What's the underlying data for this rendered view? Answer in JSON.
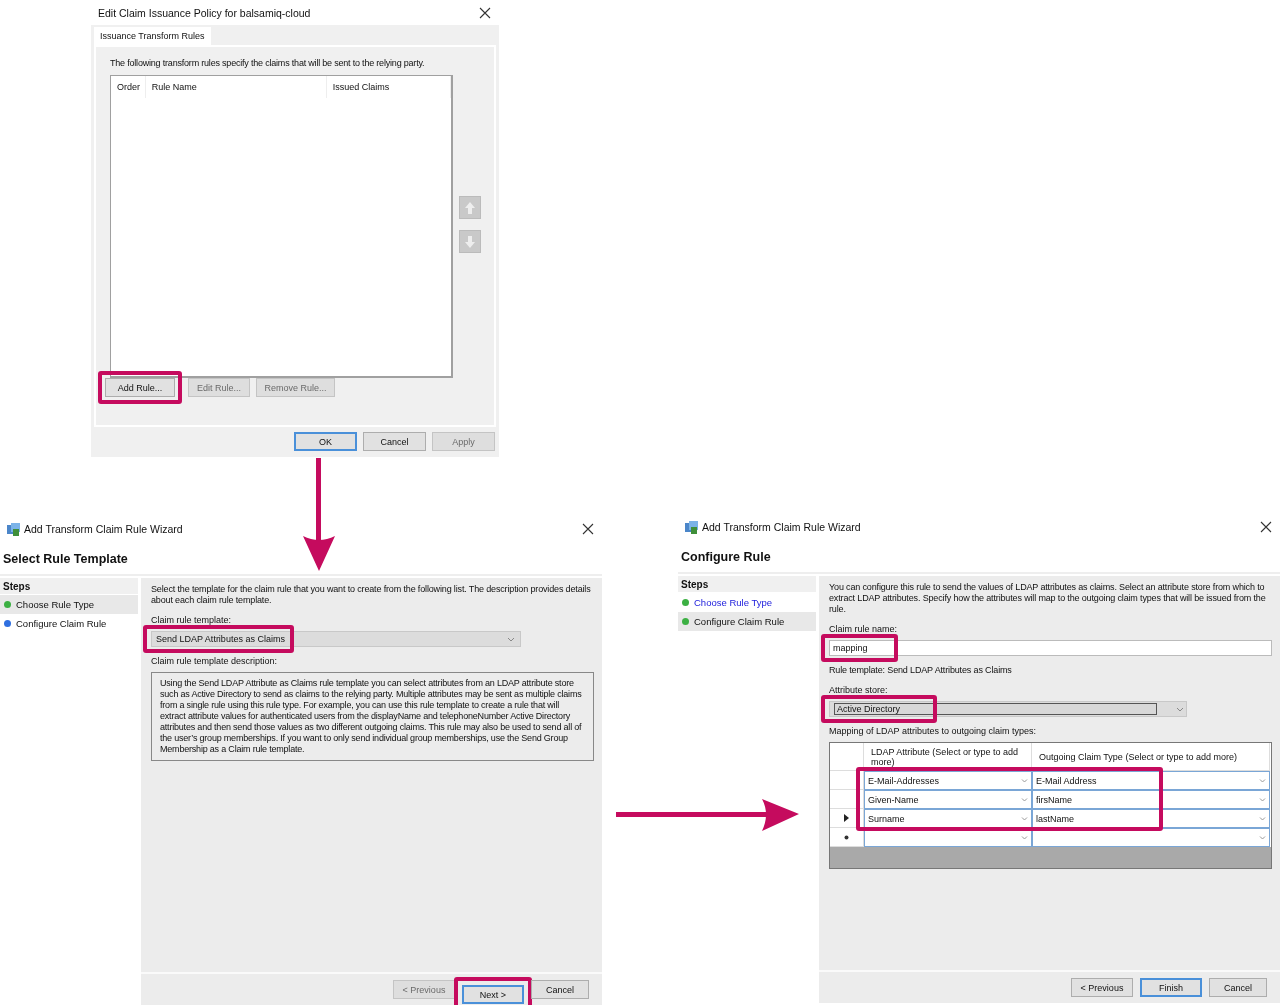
{
  "policy_dialog": {
    "title": "Edit Claim Issuance Policy for balsamiq-cloud",
    "tabs": [
      {
        "label": "Issuance Transform Rules",
        "selected": true
      }
    ],
    "description": "The following transform rules specify the claims that will be sent to the relying party.",
    "columns": [
      "Order",
      "Rule Name",
      "Issued Claims"
    ],
    "rule_buttons": [
      {
        "label": "Add Rule...",
        "disabled": false,
        "highlighted": true
      },
      {
        "label": "Edit Rule...",
        "disabled": true,
        "highlighted": false
      },
      {
        "label": "Remove Rule...",
        "disabled": true,
        "highlighted": false
      }
    ],
    "footer_buttons": [
      {
        "label": "OK",
        "disabled": false,
        "default": true
      },
      {
        "label": "Cancel",
        "disabled": false,
        "default": false
      },
      {
        "label": "Apply",
        "disabled": true,
        "default": false
      }
    ]
  },
  "select_template_wizard": {
    "title": "Add Transform Claim Rule Wizard",
    "heading": "Select Rule Template",
    "steps_title": "Steps",
    "steps": [
      {
        "label": "Choose Rule Type",
        "color": "#3cb043",
        "selected": true,
        "link": false
      },
      {
        "label": "Configure Claim Rule",
        "color": "#2f6fe0",
        "selected": false,
        "link": false
      }
    ],
    "fields": [
      {
        "kind": "text",
        "value": "Select the template for the claim rule that you want to create from the following list. The description provides details about each claim rule template."
      },
      {
        "kind": "label",
        "value": "Claim rule template:"
      },
      {
        "kind": "dropdown",
        "value": "Send LDAP Attributes as Claims",
        "highlighted": true
      },
      {
        "kind": "label",
        "value": "Claim rule template description:"
      },
      {
        "kind": "memo",
        "value": "Using the Send LDAP Attribute as Claims rule template you can select attributes from an LDAP attribute store such as Active Directory to send as claims to the relying party. Multiple attributes may be sent as multiple claims from a single rule using this rule type. For example, you can use this rule template to create a rule that will extract attribute values for authenticated users from the displayName and telephoneNumber Active Directory attributes and then send those values as two different outgoing claims. This rule may also be used to send all of the user’s group memberships. If you want to only send individual group memberships, use the Send Group Membership as a Claim rule template."
      }
    ],
    "buttons": [
      {
        "label": "< Previous",
        "disabled": true,
        "default": false,
        "highlighted": false
      },
      {
        "label": "Next >",
        "disabled": false,
        "default": true,
        "highlighted": true
      },
      {
        "label": "Cancel",
        "disabled": false,
        "default": false,
        "highlighted": false
      }
    ]
  },
  "configure_wizard": {
    "title": "Add Transform Claim Rule Wizard",
    "heading": "Configure Rule",
    "steps_title": "Steps",
    "steps": [
      {
        "label": "Choose Rule Type",
        "color": "#3cb043",
        "selected": false,
        "link": true
      },
      {
        "label": "Configure Claim Rule",
        "color": "#3cb043",
        "selected": true,
        "link": false
      }
    ],
    "fields": [
      {
        "kind": "text",
        "value": "You can configure this rule to send the values of LDAP attributes as claims. Select an attribute store from which to extract LDAP attributes. Specify how the attributes will map to the outgoing claim types that will be issued from the rule."
      },
      {
        "kind": "label",
        "value": "Claim rule name:"
      },
      {
        "kind": "input",
        "value": "mapping",
        "highlighted": true
      },
      {
        "kind": "text",
        "value": "Rule template: Send LDAP Attributes as Claims"
      },
      {
        "kind": "label",
        "value": "Attribute store:"
      },
      {
        "kind": "combo",
        "value": "Active Directory",
        "highlighted": true
      },
      {
        "kind": "label",
        "value": "Mapping of LDAP attributes to outgoing claim types:"
      },
      {
        "kind": "grid",
        "highlighted": true,
        "columns": [
          "LDAP Attribute (Select or type to add more)",
          "Outgoing Claim Type (Select or type to add more)"
        ],
        "rows": [
          {
            "kind": "data",
            "current": false,
            "cells": [
              "E-Mail-Addresses",
              "E-Mail Address"
            ]
          },
          {
            "kind": "data",
            "current": false,
            "cells": [
              "Given-Name",
              "firsName"
            ]
          },
          {
            "kind": "data",
            "current": true,
            "cells": [
              "Surname",
              "lastName"
            ]
          },
          {
            "kind": "new",
            "current": false
          }
        ]
      }
    ],
    "buttons": [
      {
        "label": "< Previous",
        "disabled": false,
        "default": false,
        "highlighted": false
      },
      {
        "label": "Finish",
        "disabled": false,
        "default": true,
        "highlighted": false
      },
      {
        "label": "Cancel",
        "disabled": false,
        "default": false,
        "highlighted": false
      }
    ]
  }
}
